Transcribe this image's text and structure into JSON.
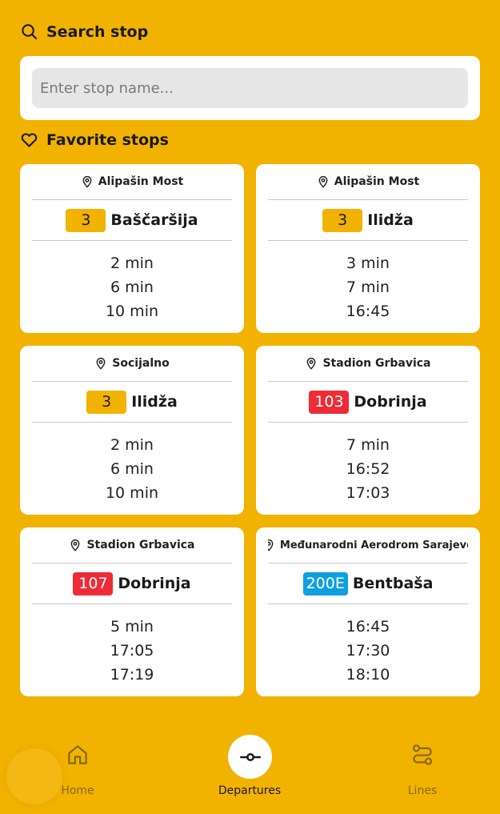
{
  "search": {
    "title": "Search stop",
    "placeholder": "Enter stop name..."
  },
  "favorites": {
    "title": "Favorite stops",
    "cards": [
      {
        "stop": "Alipašin Most",
        "line": "3",
        "line_type": "tram",
        "destination": "Baščaršija",
        "times": [
          "2 min",
          "6 min",
          "10 min"
        ]
      },
      {
        "stop": "Alipašin Most",
        "line": "3",
        "line_type": "tram",
        "destination": "Ilidža",
        "times": [
          "3 min",
          "7 min",
          "16:45"
        ]
      },
      {
        "stop": "Socijalno",
        "line": "3",
        "line_type": "tram",
        "destination": "Ilidža",
        "times": [
          "2 min",
          "6 min",
          "10 min"
        ]
      },
      {
        "stop": "Stadion Grbavica",
        "line": "103",
        "line_type": "trolleybus",
        "destination": "Dobrinja",
        "times": [
          "7 min",
          "16:52",
          "17:03"
        ]
      },
      {
        "stop": "Stadion Grbavica",
        "line": "107",
        "line_type": "trolleybus",
        "destination": "Dobrinja",
        "times": [
          "5 min",
          "17:05",
          "17:19"
        ]
      },
      {
        "stop": "Međunarodni Aerodrom Sarajevo",
        "line": "200E",
        "line_type": "bus",
        "destination": "Bentbaša",
        "times": [
          "16:45",
          "17:30",
          "18:10"
        ]
      }
    ]
  },
  "nav": {
    "items": [
      {
        "label": "Home",
        "icon": "home-icon",
        "active": false
      },
      {
        "label": "Departures",
        "icon": "departures-icon",
        "active": true
      },
      {
        "label": "Lines",
        "icon": "route-icon",
        "active": false
      }
    ]
  },
  "colors": {
    "background": "#F2B200",
    "tram": "#F2B200",
    "trolleybus": "#EF2B35",
    "bus": "#0EA0E0"
  }
}
